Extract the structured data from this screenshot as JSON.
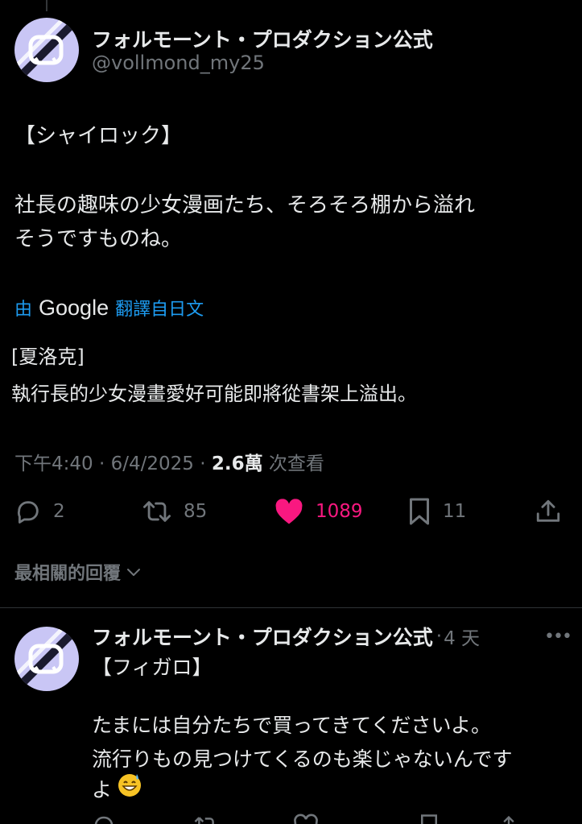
{
  "tweet": {
    "author_name": "フォルモーント・プロダクション公式",
    "author_handle": "@vollmond_my25",
    "text_line1": "【シャイロック】",
    "text_line2": "社長の趣味の少女漫画たち、そろそろ棚から溢れ",
    "text_line3": "そうですものね。",
    "translation_by": "由",
    "translation_provider": "Google",
    "translation_from": "翻譯自日文",
    "translated_line1": "[夏洛克]",
    "translated_line2": "執行長的少女漫畫愛好可能即將從書架上溢出。",
    "time": "下午4:40",
    "date": "6/4/2025",
    "views": "2.6萬",
    "views_label": "次查看",
    "replies": "2",
    "reposts": "85",
    "likes": "1089",
    "bookmarks": "11"
  },
  "relevant_replies_label": "最相關的回覆",
  "reply": {
    "author_name": "フォルモーント・プロダクション公式",
    "time": "4 天",
    "more": "•••",
    "text_line1": "【フィガロ】",
    "text_line2": "たまには自分たちで買ってきてくださいよ。",
    "text_line3": "流行りもの見つけてくるのも楽じゃないんです",
    "text_line4": "よ",
    "emoji": "😅"
  },
  "colors": {
    "background": "#000000",
    "text": "#e7e9ea",
    "muted": "#71767b",
    "link": "#1d9bf0",
    "like": "#f91880",
    "divider": "#2f3336"
  }
}
